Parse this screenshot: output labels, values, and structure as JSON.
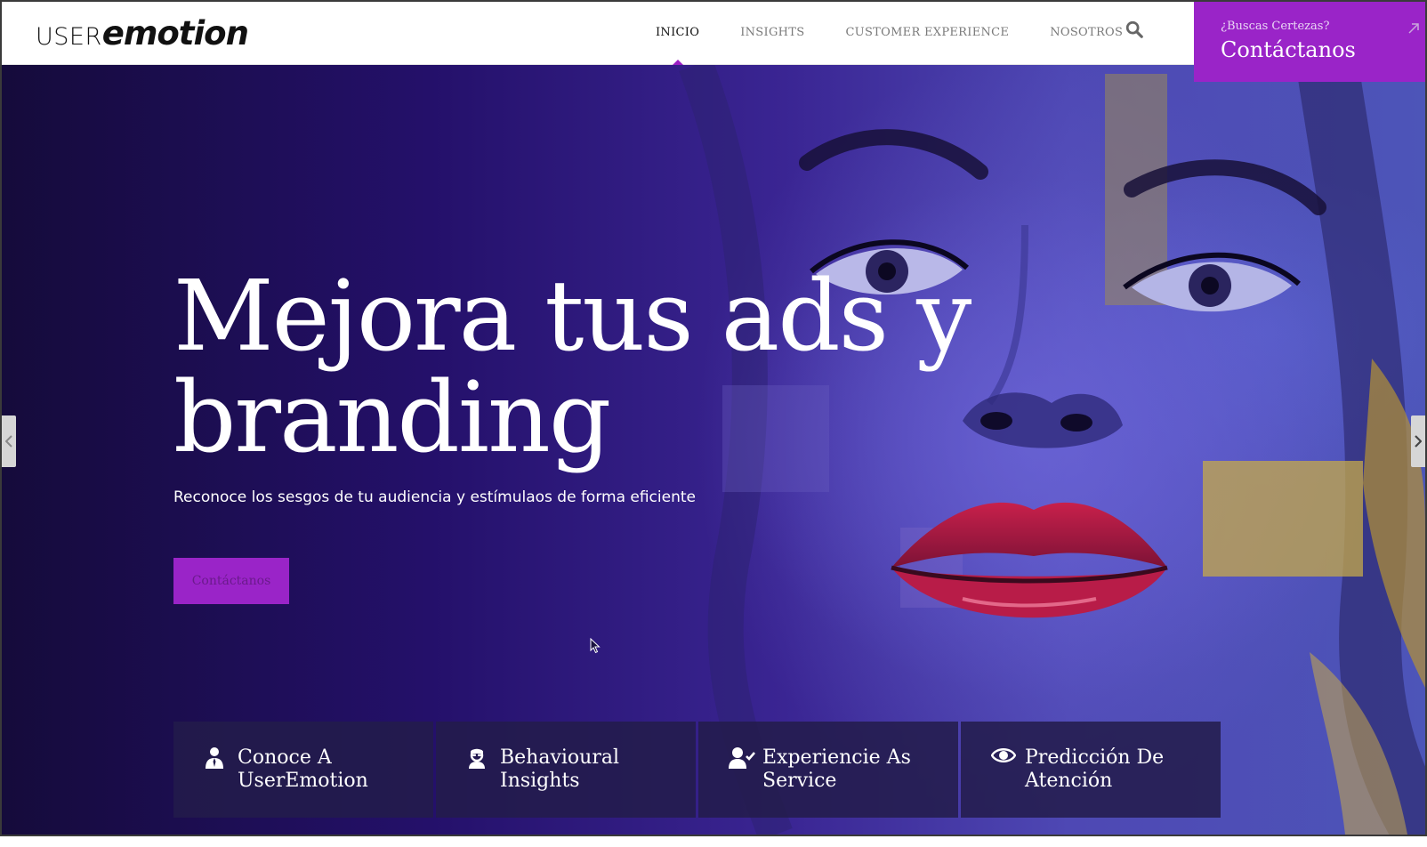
{
  "header": {
    "logo": {
      "part1": "USER",
      "part2": "emotion"
    },
    "nav": [
      {
        "label": "INICIO",
        "active": true
      },
      {
        "label": "INSIGHTS",
        "active": false
      },
      {
        "label": "CUSTOMER EXPERIENCE",
        "active": false
      },
      {
        "label": "NOSOTROS",
        "active": false
      }
    ],
    "search_icon": "search-icon",
    "cta": {
      "small": "¿Buscas Certezas?",
      "big": "Contáctanos"
    }
  },
  "hero": {
    "title_line1": "Mejora tus ads y",
    "title_line2": "branding",
    "subtitle": "Reconoce los sesgos de tu audiencia y estímulaos de forma eficiente",
    "button_label": "Contáctanos"
  },
  "features": [
    {
      "line1": "Conoce A",
      "line2": "UserEmotion",
      "icon": "person-icon"
    },
    {
      "line1": "Behavioural",
      "line2": "Insights",
      "icon": "user-secret-icon"
    },
    {
      "line1": "Experiencie As",
      "line2": "Service",
      "icon": "user-check-icon"
    },
    {
      "line1": "Predicción De",
      "line2": "Atención",
      "icon": "eye-icon"
    }
  ],
  "colors": {
    "accent": "#9a24c8",
    "hero_dark": "#150b3b",
    "hero_light": "#4d55b8",
    "card_bg": "#231c4b"
  }
}
